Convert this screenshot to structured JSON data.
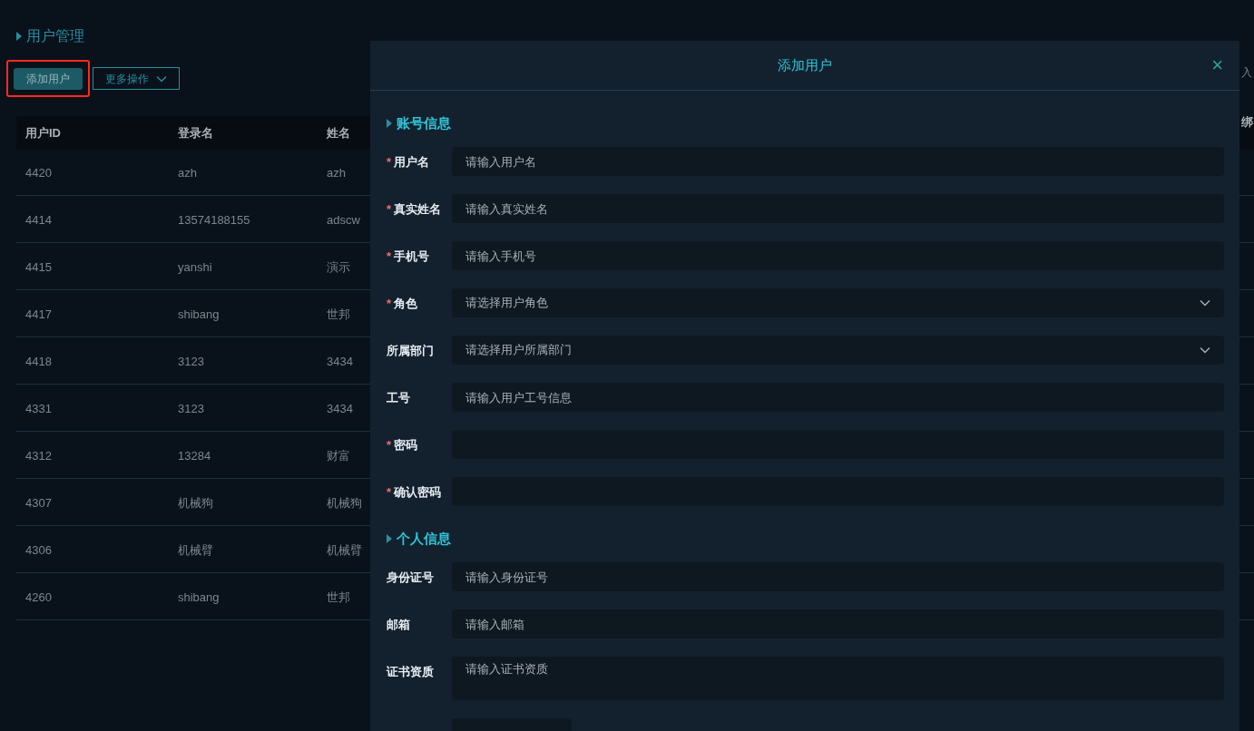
{
  "page_title": "用户管理",
  "toolbar": {
    "add_button": {
      "label": "添加用户",
      "highlighted": true
    },
    "more_button": {
      "label": "更多操作"
    }
  },
  "table": {
    "columns": [
      "用户ID",
      "登录名",
      "姓名"
    ],
    "rows": [
      [
        "4420",
        "azh",
        "azh"
      ],
      [
        "4414",
        "13574188155",
        "adscw"
      ],
      [
        "4415",
        "yanshi",
        "演示"
      ],
      [
        "4417",
        "shibang",
        "世邦"
      ],
      [
        "4418",
        "3123",
        "3434"
      ],
      [
        "4331",
        "3123",
        "3434"
      ],
      [
        "4312",
        "13284",
        "财富"
      ],
      [
        "4307",
        "机械狗",
        "机械狗"
      ],
      [
        "4306",
        "机械臂",
        "机械臂"
      ],
      [
        "4260",
        "shibang",
        "世邦"
      ]
    ]
  },
  "right_edge": {
    "toolbar_fragment": "入",
    "header_fragment": "绑"
  },
  "drawer": {
    "title": "添加用户",
    "close": "×",
    "sections": [
      {
        "title": "账号信息",
        "fields": [
          {
            "kind": "input",
            "label": "用户名",
            "required_mark": "*",
            "placeholder": "请输入用户名"
          },
          {
            "kind": "input",
            "label": "真实姓名",
            "required_mark": "*",
            "placeholder": "请输入真实姓名"
          },
          {
            "kind": "input",
            "label": "手机号",
            "required_mark": "*",
            "placeholder": "请输入手机号"
          },
          {
            "kind": "select",
            "label": "角色",
            "required_mark": "*",
            "placeholder": "请选择用户角色"
          },
          {
            "kind": "select",
            "label": "所属部门",
            "placeholder": "请选择用户所属部门"
          },
          {
            "kind": "input",
            "label": "工号",
            "placeholder": "请输入用户工号信息"
          },
          {
            "kind": "input",
            "label": "密码",
            "required_mark": "*"
          },
          {
            "kind": "input",
            "label": "确认密码",
            "required_mark": "*"
          }
        ]
      },
      {
        "title": "个人信息",
        "fields": [
          {
            "kind": "input",
            "label": "身份证号",
            "placeholder": "请输入身份证号"
          },
          {
            "kind": "input",
            "label": "邮箱",
            "placeholder": "请输入邮箱"
          },
          {
            "kind": "textarea",
            "label": "证书资质",
            "placeholder": "请输入证书资质"
          },
          {
            "kind": "partial"
          }
        ]
      }
    ]
  }
}
